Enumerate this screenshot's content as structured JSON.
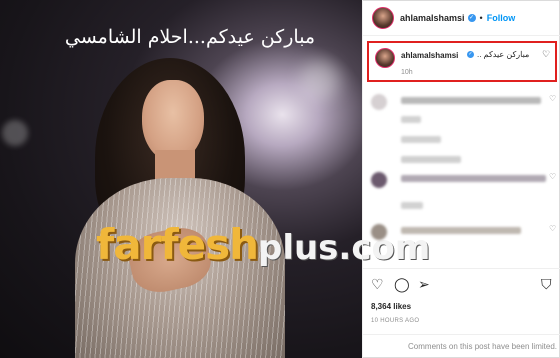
{
  "post": {
    "image_caption": "مباركن عيدكم...احلام الشامسي",
    "watermark": {
      "main": "farfesh",
      "sub": "plus.com"
    }
  },
  "header": {
    "username": "ahlamalshamsi",
    "verified_mark": "✓",
    "separator": "•",
    "follow_label": "Follow"
  },
  "caption": {
    "username": "ahlamalshamsi",
    "verified_mark": "✓",
    "text": "مباركن عيدكم ..",
    "time": "10h",
    "heart_icon": "♡"
  },
  "comments": {
    "heart_icon": "♡"
  },
  "actions": {
    "like_icon": "♡",
    "comment_icon": "◯",
    "share_icon": "➢",
    "save_icon": "⛉"
  },
  "stats": {
    "likes": "8,364 likes",
    "posted": "10 HOURS AGO"
  },
  "footer": {
    "notice": "Comments on this post have been limited."
  },
  "colors": {
    "accent_blue": "#0095f6",
    "highlight_red": "#e0201f",
    "watermark_gold": "#f0b73a"
  }
}
